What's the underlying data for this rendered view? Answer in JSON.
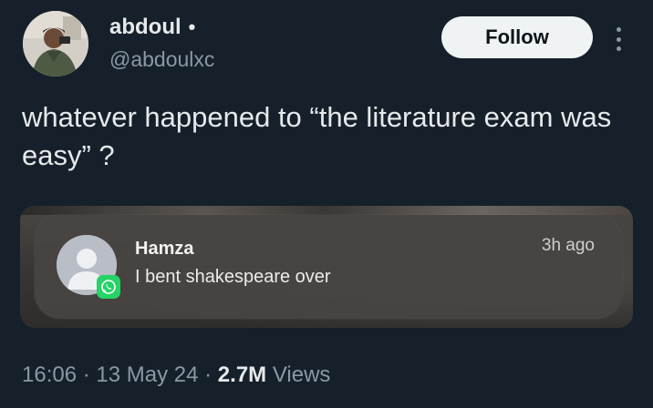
{
  "author": {
    "display_name": "abdoul",
    "separator": "•",
    "handle": "@abdoulxc"
  },
  "actions": {
    "follow_label": "Follow",
    "more_icon": "more-vertical-icon"
  },
  "tweet": {
    "text": "whatever happened to “the literature exam was easy” ?"
  },
  "media": {
    "notification": {
      "sender": "Hamza",
      "message": "I bent shakespeare over",
      "time": "3h ago",
      "app_icon": "whatsapp-icon",
      "app_color": "#25d366"
    }
  },
  "meta": {
    "time": "16:06",
    "sep1": " · ",
    "date": "13 May 24",
    "sep2": " · ",
    "views_count": "2.7M",
    "views_label": "Views"
  },
  "colors": {
    "background": "#15202b",
    "text_primary": "#e7e9ea",
    "text_secondary": "#8b98a5",
    "button_bg": "#eff3f4"
  }
}
